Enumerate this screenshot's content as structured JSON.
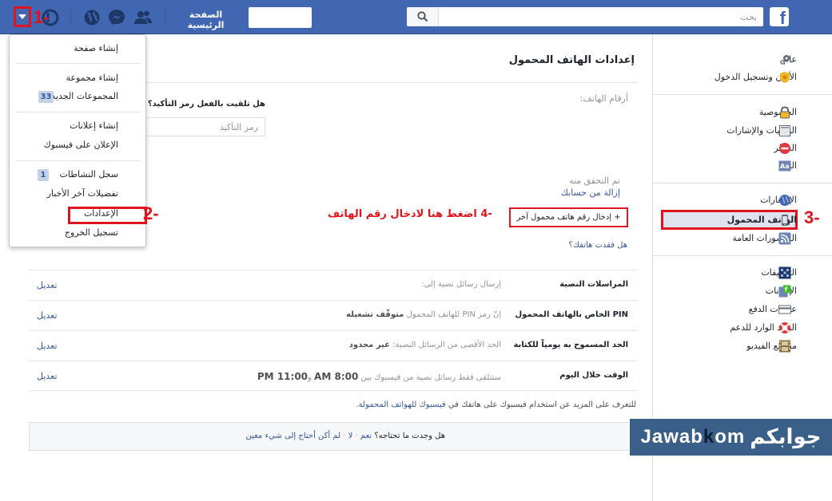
{
  "topbar": {
    "search_placeholder": "بحث",
    "home_label": "الصفحة الرئيسية",
    "logo_letter": "f"
  },
  "annotations": {
    "step1": "1-",
    "step2": "2-",
    "step3": "3-",
    "step4": "اضغط هنا لادخال رقم الهاتف",
    "step4_num": "-4"
  },
  "dropdown": {
    "items": [
      {
        "label": "إنشاء صفحة"
      },
      {
        "label": "إنشاء مجموعة"
      },
      {
        "label": "المجموعات الجديدة",
        "badge": "33"
      },
      {
        "label": "إنشاء إعلانات"
      },
      {
        "label": "الإعلان على فيسبوك"
      },
      {
        "label": "سجل النشاطات",
        "badge": "1"
      },
      {
        "label": "تفضيلات آخر الأخبار"
      },
      {
        "label": "الإعدادات"
      },
      {
        "label": "تسجيل الخروج"
      }
    ]
  },
  "main": {
    "title": "إعدادات الهاتف المحمول",
    "phone_numbers_label": "أرقام الهاتف:",
    "confirm_question": "هل تلقيت بالفعل رمز التأكيد؟",
    "confirm_placeholder": "رمز التأكيد",
    "verified_label": "تم التحقق منه",
    "remove_link": "إزالة من حسابك",
    "add_phone": "+ إدخال رقم هاتف محمول آخر",
    "lost_phone": "هل فقدت هاتفك؟",
    "settings_rows": [
      {
        "key": "المراسلات النصية",
        "val": "إرسال رسائل نصية إلى:",
        "edit": "تعديل"
      },
      {
        "key": "PIN الخاص بالهاتف المحمول",
        "val_pre": "إنّ رمز PIN للهاتف المحمول ",
        "val_bold": "متوقّف تشغيله",
        "edit": "تعديل"
      },
      {
        "key": "الحد المسموح به يومياً للكتابة",
        "val_pre": "الحد الأقصى من الرسائل النصية: ",
        "val_bold": "غير محدود",
        "edit": "تعديل"
      },
      {
        "key": "الوقت خلال اليوم",
        "val_pre": "ستتلقى فقط رسائل نصية من فيسبوك بين ",
        "t1": "8:00 AM",
        "mid": " و",
        "t2": "11:00 PM",
        "edit": "تعديل"
      }
    ],
    "learn_more_pre": "للتعرف على المزيد عن استخدام فيسبوك على هاتفك في ",
    "learn_more_link": "فيسبوك للهواتف المحمولة",
    "learn_more_post": ".",
    "feedback_q": "هل وجدت ما تحتاجه؟",
    "feedback_yes": "نعم",
    "feedback_no": "لا",
    "feedback_other": "لم أكن أحتاج إلى شيء معين",
    "feedback_dot1": "·",
    "feedback_dot2": "·"
  },
  "sidebar": {
    "items": [
      {
        "label": "عام",
        "icon": "gear-icon"
      },
      {
        "label": "الأمان وتسجيل الدخول",
        "icon": "badge-icon"
      },
      {
        "label": "الخصوصية",
        "icon": "lock-icon"
      },
      {
        "label": "اليوميات والإشارات",
        "icon": "timeline-icon"
      },
      {
        "label": "الحظر",
        "icon": "block-icon"
      },
      {
        "label": "اللغة",
        "icon": "language-icon"
      },
      {
        "label": "الإشعارات",
        "icon": "globe-icon"
      },
      {
        "label": "الهاتف المحمول",
        "icon": "mobile-icon"
      },
      {
        "label": "المنشورات العامة",
        "icon": "rss-icon"
      },
      {
        "label": "التطبيقات",
        "icon": "apps-icon"
      },
      {
        "label": "الإعلانات",
        "icon": "ads-icon"
      },
      {
        "label": "عمليات الدفع",
        "icon": "card-icon"
      },
      {
        "label": "البريد الوارد للدعم",
        "icon": "lifebuoy-icon"
      },
      {
        "label": "مقاطع الفيديو",
        "icon": "film-icon"
      }
    ]
  },
  "watermark": {
    "arabic": "جوابكم",
    "en_1": "Jawab",
    "en_2": "k",
    "en_3": "om"
  },
  "colors": {
    "brand": "#4267b2",
    "annotation": "#e0141e",
    "link": "#365899"
  }
}
